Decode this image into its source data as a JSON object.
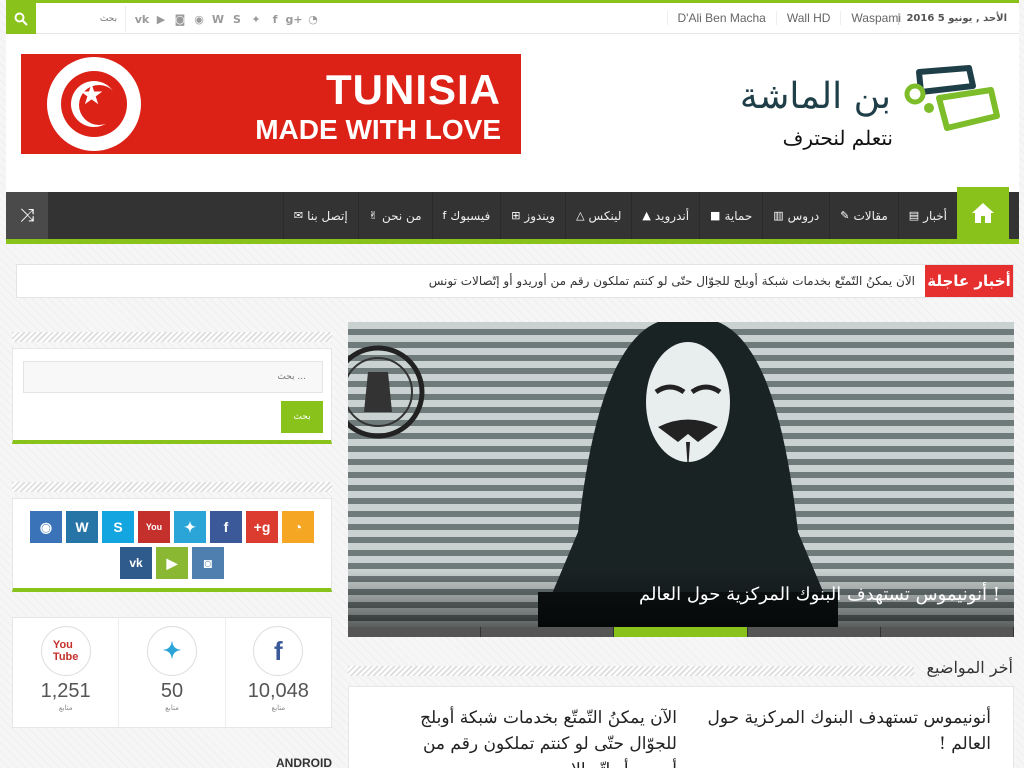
{
  "topbar": {
    "search_placeholder": "بحث",
    "social_icons": [
      "rss-icon",
      "google-plus-icon",
      "facebook-icon",
      "twitter-icon",
      "skype-icon",
      "wordpress-icon",
      "github-icon",
      "instagram-icon",
      "youtube-icon",
      "vk-icon"
    ],
    "links": [
      "D'Ali Ben Macha",
      "Wall HD",
      "Waspami"
    ],
    "date": "الأحد , يونيو 5 2016"
  },
  "banner": {
    "line1": "TUNISIA",
    "line2": "MADE WITH LOVE"
  },
  "logo": {
    "title": "بن الماشة",
    "subtitle": "نتعلم لنحترف"
  },
  "nav": {
    "items": [
      {
        "label": "أخبار",
        "icon": "newspaper-icon"
      },
      {
        "label": "مقالات",
        "icon": "edit-icon"
      },
      {
        "label": "دروس",
        "icon": "book-icon"
      },
      {
        "label": "حماية",
        "icon": "lock-icon"
      },
      {
        "label": "أندرويد",
        "icon": "android-icon"
      },
      {
        "label": "لينكس",
        "icon": "linux-icon"
      },
      {
        "label": "ويندوز",
        "icon": "windows-icon"
      },
      {
        "label": "فيسبوك",
        "icon": "facebook-icon"
      },
      {
        "label": "من نحن",
        "icon": "hand-icon"
      },
      {
        "label": "إتصل بنا",
        "icon": "envelope-icon"
      }
    ]
  },
  "breaking": {
    "label": "أخبار عاجلة",
    "text": "الآن يمكنُ التّمتّع بخدمات شبكة أوبلج للجوّال حتّى لو كنتم تملكون رقم من أوريدو أو إتّصالات تونس"
  },
  "sidebar": {
    "search_placeholder": "بحث ...",
    "search_button": "بحث",
    "counters": [
      {
        "icon": "facebook-icon",
        "value": "10,048",
        "label": "متابع"
      },
      {
        "icon": "twitter-icon",
        "value": "50",
        "label": "متابع"
      },
      {
        "icon": "youtube-icon",
        "value": "1,251",
        "label": "متابع"
      }
    ],
    "next_heading": "ANDROID"
  },
  "slider": {
    "caption": "أنونيموس تستهدف البنوك المركزية حول العالم !"
  },
  "latest": {
    "title": "أخر المواضيع",
    "posts": [
      "أنونيموس تستهدف البنوك المركزية حول العالم !",
      "الآن يمكنُ التّمتّع بخدمات شبكة أوبلج للجوّال حتّى لو كنتم تملكون رقم من أوريدو أو إتّصالات"
    ]
  },
  "colors": {
    "accent": "#88c21a",
    "breaking": "#e63030",
    "nav_bg": "#333333"
  }
}
